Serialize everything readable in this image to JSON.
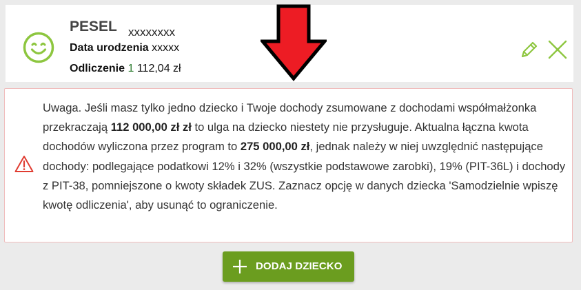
{
  "child_card": {
    "pesel_label": "PESEL",
    "pesel_value": "xxxxxxxx",
    "dob_label": "Data urodzenia",
    "dob_value": "xxxxx",
    "deduction_label": "Odliczenie",
    "deduction_value_prefix": "1",
    "deduction_value_rest": "112,04 zł",
    "avatar_icon": "smiley-face-icon",
    "edit_icon": "pencil-icon",
    "delete_icon": "close-icon"
  },
  "annotation": {
    "icon": "red-down-arrow",
    "color": "#ed1c24"
  },
  "warning": {
    "icon": "warning-triangle-icon",
    "text_1": "Uwaga. Jeśli masz tylko jedno dziecko i Twoje dochody zsumowane z dochodami współmałżonka przekraczają ",
    "amount_limit": "112 000,00 zł zł",
    "text_2": " to ulga na dziecko niestety nie przysługuje. Aktualna łączna kwota dochodów wyliczona przez program to ",
    "amount_current": "275 000,00 zł",
    "text_3": ", jednak należy w niej uwzględnić następujące dochody: podlegające podatkowi 12% i 32% (wszystkie podstawowe zarobki), 19% (PIT-36L) i dochody z PIT-38, pomniejszone o kwoty składek ZUS. Zaznacz opcję w danych dziecka 'Samodzielnie wpiszę kwotę odliczenia', aby usunąć to ograniczenie."
  },
  "add_button": {
    "label": "DODAJ DZIECKO",
    "icon": "plus-icon"
  },
  "colors": {
    "accent_green": "#8dc63f",
    "button_green": "#6b9d1f",
    "warning_red": "#e03c31",
    "background": "#ebebeb"
  }
}
